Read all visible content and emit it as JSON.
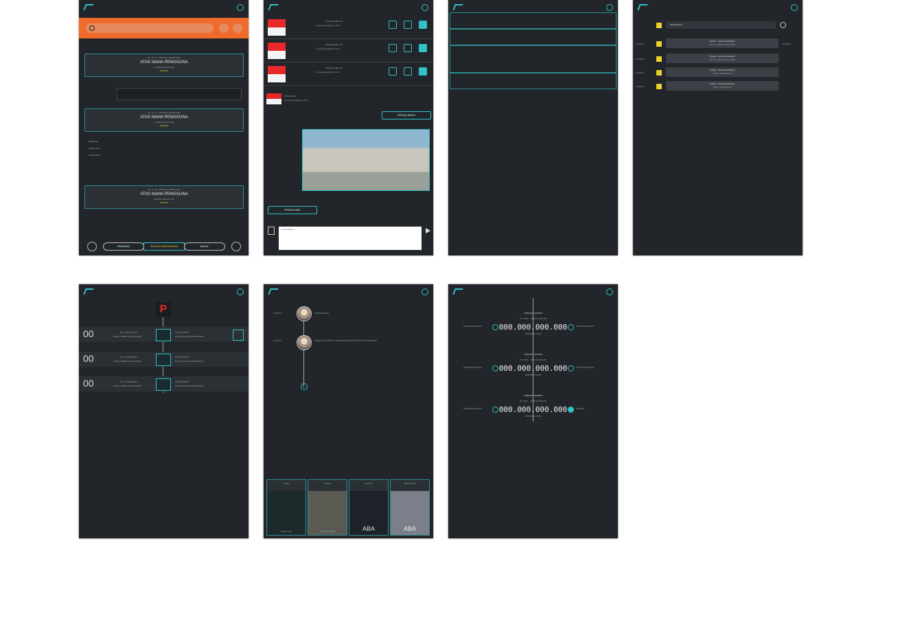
{
  "screen1": {
    "search_placeholder": "",
    "cards": [
      {
        "top": "NO. ID. PL. TANGGAL PENGGUNA",
        "name": "ATAS NAMA PENGGUNA",
        "sub": "ALAMAT PENGGUNA",
        "status": "SELESAI"
      },
      {
        "top": "NO. ID. PL. TANGGAL PENGGUNA",
        "name": "ATAS NAMA PENGGUNA",
        "sub": "ALAMAT PENGGUNA",
        "status": "SELESAI"
      },
      {
        "top": "NO. ID. PL. TANGGAL PENGGUNA",
        "name": "ATAS NAMA PENGGUNA",
        "sub": "ALAMAT PENGGUNA",
        "status": "SELESAI"
      }
    ],
    "table_rows": [
      "ORIGINAL",
      "PENGGUNA",
      "AKSESORIS"
    ],
    "tabs": [
      "PENDING",
      "SUDAH DIKERJAKAN",
      "BATAL"
    ]
  },
  "screen2": {
    "messages": [
      {
        "line1": "TANGGAL/BULAN",
        "line2": "id_pengguna@yahoo.com"
      },
      {
        "line1": "TANGGAL/BULAN",
        "line2": "id_pengguna@yahoo.com"
      },
      {
        "line1": "TANGGAL/BULAN",
        "line2": "id_pengguna@yahoo.com"
      }
    ],
    "header_name": "PENGGUNA",
    "header_email": "id.pengguna@yahoo.com",
    "bubble_right": "PESAN BARU",
    "bubble_left": "PENGGUNA",
    "input_placeholder": "TULIS PESAN..."
  },
  "screen4": {
    "search_value": "PENCARIAN",
    "rows": [
      {
        "left": "00.00.00",
        "name": "NAMA - JASA KARYAWAN",
        "sub": "WAKTU KERJA KARYAWAN",
        "right": "00.00.00"
      },
      {
        "left": "00.00.00",
        "name": "NAMA - JASA KARYAWAN",
        "sub": "WAKTU KERJA KARYAWAN",
        "right": ""
      },
      {
        "left": "00.00.00",
        "name": "NAMA - JASA KARYAWAN",
        "sub": "TIDAK DITEMUKAN",
        "right": ""
      },
      {
        "left": "00.00.00",
        "name": "NAMA - JASA KARYAWAN",
        "sub": "TIDAK DITEMUKAN",
        "right": ""
      }
    ]
  },
  "screen5": {
    "parking_label": "P",
    "rows": [
      {
        "left": "00",
        "id": "NO. KENDARAAN",
        "type": "JENIS / MEREK KENDARAAN",
        "right_title": "KODE PARKIR",
        "right_sub": "WAKTU MASUK KENDARAAN"
      },
      {
        "left": "00",
        "id": "NO. KENDARAAN",
        "type": "JENIS / MEREK KENDARAAN",
        "right_title": "KODE PARKIR",
        "right_sub": "WAKTU MASUK KENDARAAN"
      },
      {
        "left": "00",
        "id": "NO. KENDARAAN",
        "type": "JENIS / MEREK KENDARAAN",
        "right_title": "KODE PARKIR",
        "right_sub": "WAKTU MASUK KENDARAAN"
      }
    ]
  },
  "screen6": {
    "entries": [
      {
        "time": "00.00.00",
        "name": "ID PENGGUNA",
        "note": "ID PENGGUNA"
      },
      {
        "time": "00.00.00",
        "name": "ID PENGGUNA",
        "note": "PENGGUNA PESAN: PENDAFTARAN ANTRIAN PADA FORMULIR"
      }
    ],
    "heroes": [
      {
        "top": "ZACK",
        "bottom": "ZACK FAIR"
      },
      {
        "top": "CLOUD",
        "bottom": "CLOUD STRIFE"
      },
      {
        "top": "NOCTIS",
        "bottom": "ABA"
      },
      {
        "top": "SEPHIROTH",
        "bottom": "ABA"
      }
    ]
  },
  "screen7": {
    "blocks": [
      {
        "title": "CABANG / NOMOR",
        "sub": "NO. REG. : 00.00.00.000.000",
        "amount": "000.000.000.000",
        "date": "00/00/0000 00:00",
        "left": "NAMA PENGGUNA",
        "right": "NAMA PENGGUNA"
      },
      {
        "title": "CABANG / NOMOR",
        "sub": "NO. REG. : 00.00.00.000.000",
        "amount": "000.000.000.000",
        "date": "00/00/0000 00:00",
        "left": "NAMA PENGGUNA",
        "right": "NAMA PENGGUNA"
      },
      {
        "title": "CABANG / NOMOR",
        "sub": "NO. REG. : 00.00.00.000.000",
        "amount": "000.000.000.000",
        "date": "00/00/0000 00:00",
        "left": "NAMA PENGGUNA",
        "right": "SELESAI"
      }
    ]
  }
}
